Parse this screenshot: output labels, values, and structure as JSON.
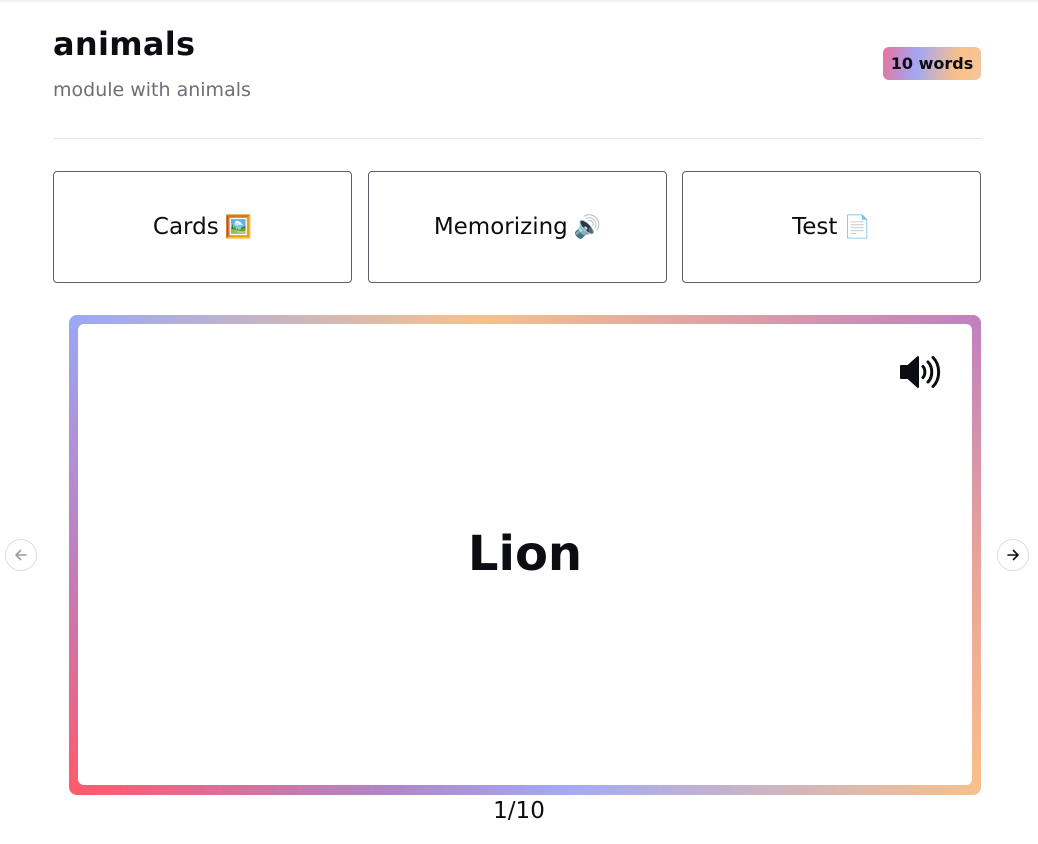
{
  "module": {
    "title": "animals",
    "description": "module with animals",
    "word_count_badge": "10 words"
  },
  "modes": [
    {
      "label": "Cards",
      "emoji": "🖼️"
    },
    {
      "label": "Memorizing",
      "emoji": "🔊"
    },
    {
      "label": "Test",
      "emoji": "📄"
    }
  ],
  "card": {
    "word": "Lion",
    "speaker_icon": "speaker-volume-icon"
  },
  "navigation": {
    "prev_icon": "arrow-left-icon",
    "next_icon": "arrow-right-icon",
    "position_text": "1/10",
    "current": 1,
    "total": 10
  },
  "colors": {
    "text": "#0b0d12",
    "muted": "#6b6f76",
    "gradient": [
      "#ff5a6b",
      "#b086c8",
      "#9aa8f6",
      "#f9c08a"
    ]
  }
}
